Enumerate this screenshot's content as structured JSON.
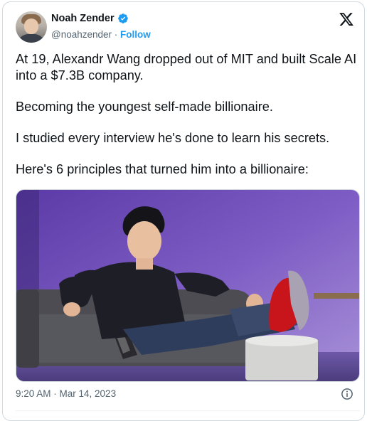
{
  "author": {
    "name": "Noah Zender",
    "handle": "@noahzender",
    "separator": "·",
    "follow_label": "Follow",
    "verified_color": "#1d9bf0"
  },
  "tweet": {
    "paragraphs": [
      "At 19, Alexandr Wang dropped out of MIT and built Scale AI into a $7.3B company.",
      "Becoming the youngest self-made billionaire.",
      "I studied every interview he's done to learn his secrets.",
      "Here's 6 principles that turned him into a billionaire:"
    ],
    "timestamp": "9:20 AM · Mar 14, 2023"
  },
  "icons": {
    "logo": "x-logo-icon",
    "verified": "verified-badge-icon",
    "info": "info-icon"
  }
}
